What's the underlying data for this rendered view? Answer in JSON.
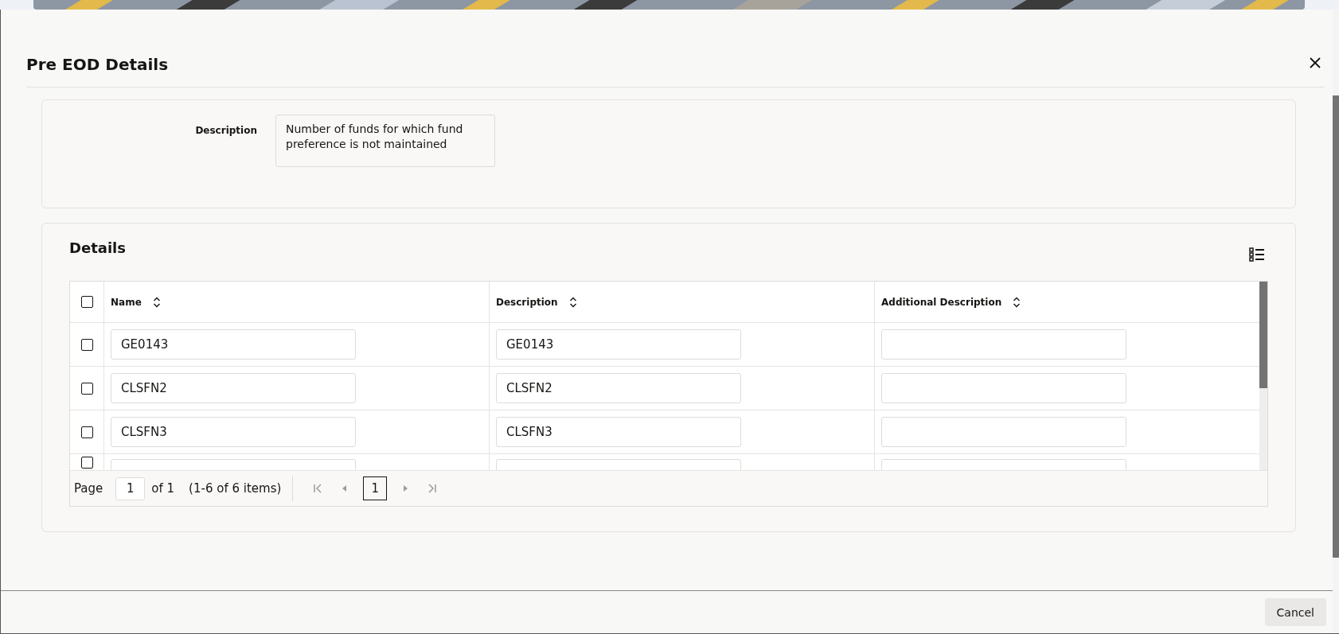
{
  "dialog": {
    "title": "Pre EOD Details"
  },
  "summary": {
    "label": "Description",
    "value": "Number of funds for which  fund preference is not maintained"
  },
  "details": {
    "title": "Details",
    "table": {
      "select_all": {
        "checked": false
      },
      "columns": [
        "Name",
        "Description",
        "Additional Description"
      ],
      "rows": [
        {
          "kind": "full",
          "checked": false,
          "name": "GE0143",
          "description": "GE0143"
        },
        {
          "kind": "full",
          "checked": false,
          "name": "CLSFN2",
          "description": "CLSFN2"
        },
        {
          "kind": "full",
          "checked": false,
          "name": "CLSFN3",
          "description": "CLSFN3"
        },
        {
          "kind": "partial"
        }
      ]
    },
    "pagination": {
      "page_label": "Page",
      "page_value": "1",
      "of_label": "of 1",
      "range": "(1-6 of 6 items)",
      "pages": [
        {
          "label": "1",
          "selected": true
        }
      ]
    }
  },
  "buttons": [
    "Cancel"
  ]
}
